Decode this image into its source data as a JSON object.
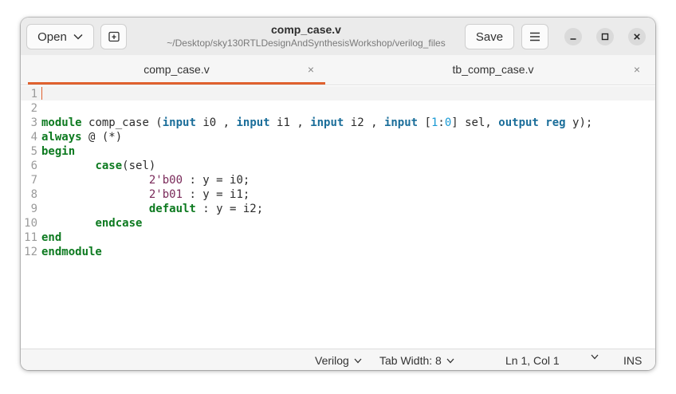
{
  "header": {
    "open_label": "Open",
    "title": "comp_case.v",
    "subtitle": "~/Desktop/sky130RTLDesignAndSynthesisWorkshop/verilog_files",
    "save_label": "Save"
  },
  "tabs": [
    {
      "label": "comp_case.v",
      "close": "×",
      "active": true
    },
    {
      "label": "tb_comp_case.v",
      "close": "×",
      "active": false
    }
  ],
  "editor": {
    "line_numbers": [
      "1",
      "2",
      "3",
      "4",
      "5",
      "6",
      "7",
      "8",
      "9",
      "10",
      "11",
      "12"
    ],
    "lines": [
      [],
      [],
      [
        {
          "t": "module ",
          "c": "kw"
        },
        {
          "t": "comp_case (",
          "c": ""
        },
        {
          "t": "input",
          "c": "ty"
        },
        {
          "t": " i0 , ",
          "c": ""
        },
        {
          "t": "input",
          "c": "ty"
        },
        {
          "t": " i1 , ",
          "c": ""
        },
        {
          "t": "input",
          "c": "ty"
        },
        {
          "t": " i2 , ",
          "c": ""
        },
        {
          "t": "input",
          "c": "ty"
        },
        {
          "t": " [",
          "c": ""
        },
        {
          "t": "1",
          "c": "num"
        },
        {
          "t": ":",
          "c": ""
        },
        {
          "t": "0",
          "c": "num"
        },
        {
          "t": "] sel, ",
          "c": ""
        },
        {
          "t": "output",
          "c": "ty"
        },
        {
          "t": " ",
          "c": ""
        },
        {
          "t": "reg",
          "c": "ty"
        },
        {
          "t": " y);",
          "c": ""
        }
      ],
      [
        {
          "t": "always",
          "c": "kw"
        },
        {
          "t": " @ (*)",
          "c": ""
        }
      ],
      [
        {
          "t": "begin",
          "c": "kw"
        }
      ],
      [
        {
          "t": "        ",
          "c": ""
        },
        {
          "t": "case",
          "c": "kw"
        },
        {
          "t": "(sel)",
          "c": ""
        }
      ],
      [
        {
          "t": "                ",
          "c": ""
        },
        {
          "t": "2'b00",
          "c": "lit"
        },
        {
          "t": " : y = i0;",
          "c": ""
        }
      ],
      [
        {
          "t": "                ",
          "c": ""
        },
        {
          "t": "2'b01",
          "c": "lit"
        },
        {
          "t": " : y = i1;",
          "c": ""
        }
      ],
      [
        {
          "t": "                ",
          "c": ""
        },
        {
          "t": "default",
          "c": "kw"
        },
        {
          "t": " : y = i2;",
          "c": ""
        }
      ],
      [
        {
          "t": "        ",
          "c": ""
        },
        {
          "t": "endcase",
          "c": "kw"
        }
      ],
      [
        {
          "t": "end",
          "c": "kw"
        }
      ],
      [
        {
          "t": "endmodule",
          "c": "kw"
        }
      ]
    ]
  },
  "statusbar": {
    "language": "Verilog",
    "tab_width": "Tab Width: 8",
    "position": "Ln 1, Col 1",
    "mode": "INS"
  },
  "icons": {
    "open_dropdown": "chevron-down-icon",
    "new_tab": "new-tab-icon",
    "menu": "hamburger-menu-icon",
    "minimize": "minimize-icon",
    "maximize": "maximize-icon",
    "close": "close-icon"
  },
  "colors": {
    "accent": "#e0612f",
    "keyword": "#0d7a20",
    "type": "#1b6e9a",
    "number": "#1a9ad4",
    "literal": "#7a2a5a"
  }
}
